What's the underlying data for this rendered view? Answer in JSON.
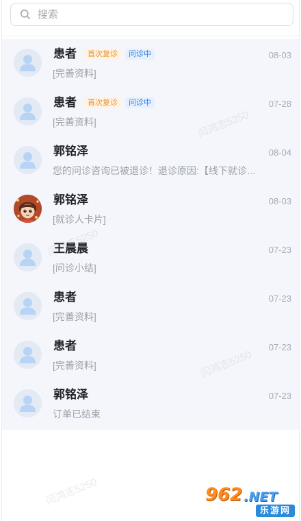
{
  "search": {
    "placeholder": "搜索"
  },
  "conversations": [
    {
      "name": "患者",
      "tags": [
        "首次复诊",
        "问诊中"
      ],
      "preview": "[完善资料]",
      "date": "08-03",
      "avatar": "default"
    },
    {
      "name": "患者",
      "tags": [
        "首次复诊",
        "问诊中"
      ],
      "preview": "[完善资料]",
      "date": "07-28",
      "avatar": "default"
    },
    {
      "name": "郭铭泽",
      "tags": [],
      "preview": "您的问诊咨询已被退诊！退诊原因:【线下就诊…",
      "date": "08-04",
      "avatar": "default"
    },
    {
      "name": "郭铭泽",
      "tags": [],
      "preview": "[就诊人卡片]",
      "date": "08-03",
      "avatar": "photo"
    },
    {
      "name": "王晨晨",
      "tags": [],
      "preview": "[问诊小结]",
      "date": "07-23",
      "avatar": "default"
    },
    {
      "name": "患者",
      "tags": [],
      "preview": "[完善资料]",
      "date": "07-23",
      "avatar": "default"
    },
    {
      "name": "患者",
      "tags": [],
      "preview": "[完善资料]",
      "date": "07-23",
      "avatar": "default"
    },
    {
      "name": "郭铭泽",
      "tags": [],
      "preview": "订单已结束",
      "date": "07-23",
      "avatar": "default"
    }
  ],
  "watermark": {
    "text": "闫鸿志5250"
  },
  "logo": {
    "number": "962",
    "suffix": ".NET",
    "subtitle": "乐游网"
  },
  "colors": {
    "tag_orange": "#e9952b",
    "tag_blue": "#2f7be8",
    "list_background": "#f4f6fb",
    "avatar_blue": "#b7d3f5"
  }
}
